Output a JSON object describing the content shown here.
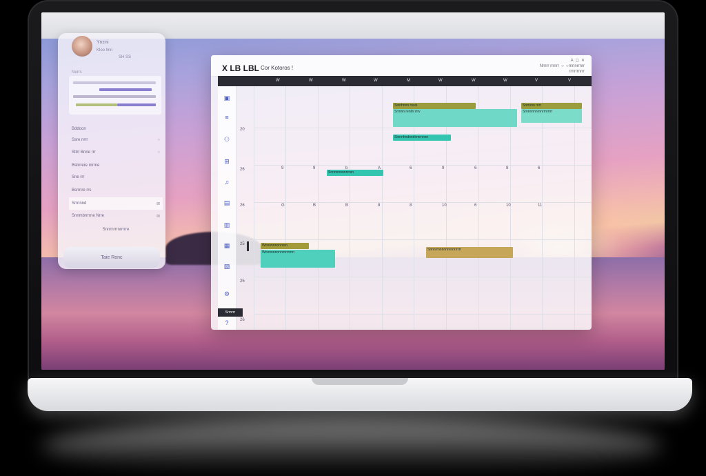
{
  "profile": {
    "name": "Ynzni",
    "meta": "Kloo  lmn",
    "stats": "SH  SS"
  },
  "sidebar": {
    "section_label": "Nerrs",
    "items": [
      {
        "label": "Bddoon",
        "tag": ""
      },
      {
        "label": "Ssre nrrr",
        "tag": "○"
      },
      {
        "label": "Sttrr Bnne rrr",
        "tag": "○"
      },
      {
        "label": "Bsbrrere mrrne",
        "tag": ""
      },
      {
        "label": "Sne rrr",
        "tag": ""
      },
      {
        "label": "Bsrrnre rrs",
        "tag": ""
      },
      {
        "label": "Srrnnnd",
        "tag": "⊠"
      },
      {
        "label": "Snnmbrrrrne Nrre",
        "tag": "⊠"
      },
      {
        "label": "Snnrnrrrnrrrrre",
        "tag": ""
      }
    ],
    "button_label": "Taie Ronc"
  },
  "calendar": {
    "title": "X LB LBL",
    "subtitle": "Cor Kotoros !",
    "toolbar": "A  ◻  ✕\nNrnrr rnnrr  ○  ○rnnnrrnrr\nrrnrrrnrrr",
    "days": [
      "W",
      "W",
      "W",
      "W",
      "M",
      "W",
      "W",
      "W",
      "V",
      "V"
    ],
    "week_numbers": [
      "",
      "20",
      "26",
      "26",
      "25",
      "25",
      "26"
    ],
    "rail_badge": "Srrnrrr",
    "events": [
      {
        "label": "Sinnhnnn rnsoi",
        "color": "#9a9c3e"
      },
      {
        "label": "Srrnnn renlni rrrv",
        "color": "#34c5b0"
      },
      {
        "label": "Srrnnnn rnrr",
        "color": "#9a9c3e"
      },
      {
        "label": "Srnnnnnnrnnrrnrrrrr",
        "color": "#34c5b0"
      },
      {
        "label": "Sinnnhndnnrlnmrnnnn",
        "color": "#34c5b0"
      },
      {
        "label": "Snnnnnnnnnrrsn",
        "color": "#34c5b0"
      },
      {
        "label": "Wnnnnnnnnnnrn",
        "color": "#a39a3a"
      },
      {
        "label": "Wnnnnnnnnnrnrrrrrrn",
        "color": "#34c5b0"
      },
      {
        "label": "Snnnrrnnnnnnrnnrrrrrr",
        "color": "#c6a659"
      }
    ]
  }
}
